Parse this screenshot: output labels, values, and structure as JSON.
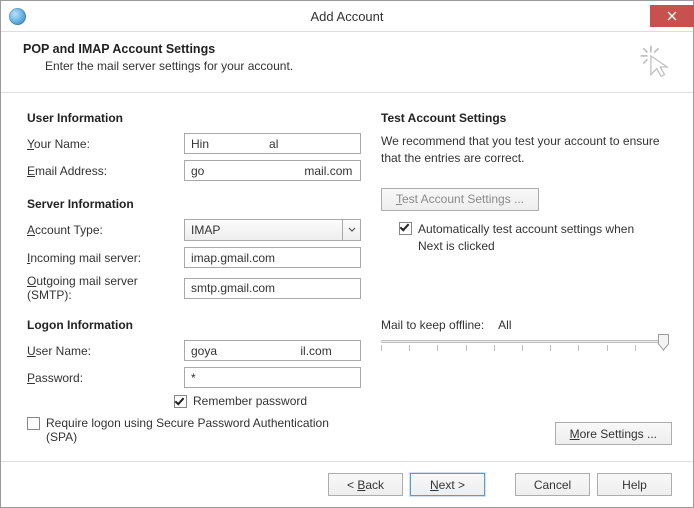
{
  "window": {
    "title": "Add Account"
  },
  "header": {
    "title": "POP and IMAP Account Settings",
    "subtitle": "Enter the mail server settings for your account."
  },
  "left": {
    "user_info_title": "User Information",
    "your_name_label_pre": "Y",
    "your_name_label_post": "our Name:",
    "your_name_value": "Hin                  al",
    "email_label_pre": "E",
    "email_label_post": "mail Address:",
    "email_value": "go                              mail.com",
    "server_info_title": "Server Information",
    "account_type_label_pre": "A",
    "account_type_label_post": "ccount Type:",
    "account_type_value": "IMAP",
    "incoming_label_pre": "I",
    "incoming_label_post": "ncoming mail server:",
    "incoming_value": "imap.gmail.com",
    "outgoing_label_pre": "O",
    "outgoing_label_post": "utgoing mail server (SMTP):",
    "outgoing_value": "smtp.gmail.com",
    "logon_info_title": "Logon Information",
    "username_label_pre": "U",
    "username_label_post": "ser Name:",
    "username_value": "goya                         il.com",
    "password_label_pre": "P",
    "password_label_post": "assword:",
    "password_value": "*",
    "remember_label_pre": "R",
    "remember_label_post": "emember password",
    "spa_label_pre": "Re",
    "spa_label_u": "q",
    "spa_label_post": "uire logon using Secure Password Authentication (SPA)"
  },
  "right": {
    "title": "Test Account Settings",
    "desc": "We recommend that you test your account to ensure that the entries are correct.",
    "test_btn_pre": "T",
    "test_btn_post": "est Account Settings ...",
    "auto_test_pre": "Automatically test account ",
    "auto_test_u": "s",
    "auto_test_post": "ettings when Next is clicked",
    "mail_offline_label": "Mail to keep offline:",
    "mail_offline_value": "All",
    "more_btn_pre": "M",
    "more_btn_post": "ore Settings ..."
  },
  "footer": {
    "back_pre": "< ",
    "back_u": "B",
    "back_post": "ack",
    "next_pre": "N",
    "next_post": "ext >",
    "cancel": "Cancel",
    "help": "Help"
  }
}
